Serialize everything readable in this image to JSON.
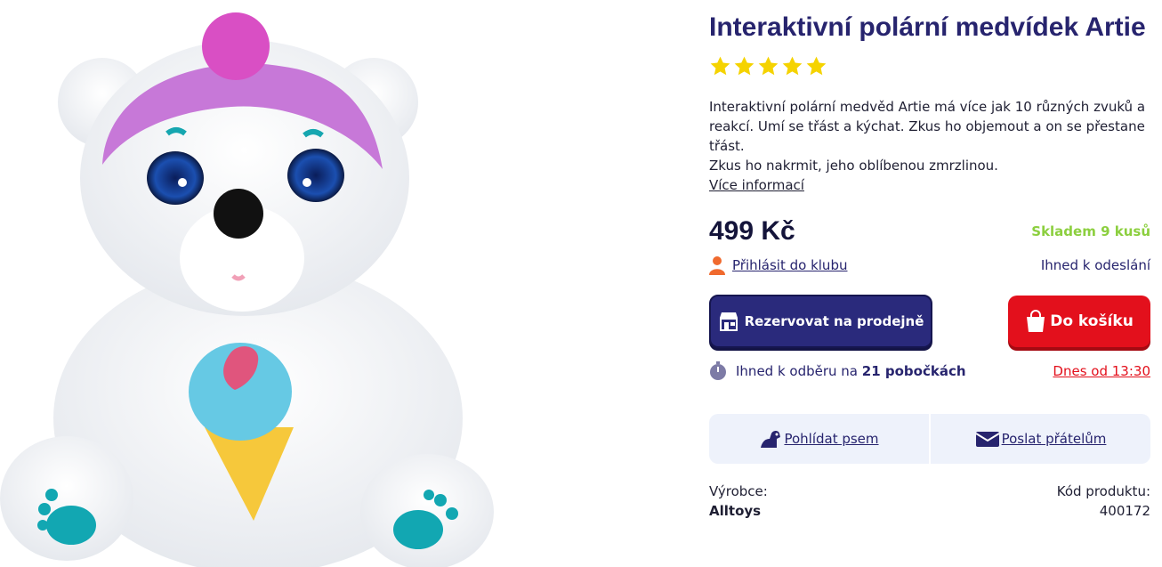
{
  "product": {
    "title": "Interaktivní polární medvídek Artie",
    "rating_stars": 5,
    "star_color": "#f5d300",
    "description_lines": [
      "Interaktivní polární medvěd Artie má více jak 10 různých zvuků a reakcí. Umí se třást a kýchat. Zkus ho objemout a on se přestane třást.",
      "Zkus ho nakrmit, jeho oblíbenou zmrzlinou."
    ],
    "more_info_label": "Více informací",
    "price": "499 Kč",
    "stock": "Skladem 9 kusů",
    "club_link": "Přihlásit do klubu",
    "shipping": "Ihned k odeslání",
    "reserve_button": "Rezervovat na prodejně",
    "cart_button": "Do košíku",
    "pickup_prefix": "Ihned k odběru na",
    "pickup_stores": "21 pobočkách",
    "pickup_time": "Dnes od 13:30",
    "watchdog_label": "Pohlídat psem",
    "share_label": "Poslat přátelům",
    "manufacturer_label": "Výrobce:",
    "manufacturer_value": "Alltoys",
    "code_label": "Kód produktu:",
    "code_value": "400172"
  },
  "colors": {
    "title": "#27246e",
    "reserve_bg": "#2a2a7c",
    "cart_bg": "#e3101c",
    "stock": "#8ccf3f",
    "accent_red": "#e3101c",
    "actions_bg": "#eef2fb"
  },
  "icons": {
    "club": "person-icon",
    "reserve": "store-icon",
    "cart": "shopping-bag-icon",
    "pickup": "stopwatch-icon",
    "watchdog": "dog-icon",
    "share": "envelope-icon"
  }
}
